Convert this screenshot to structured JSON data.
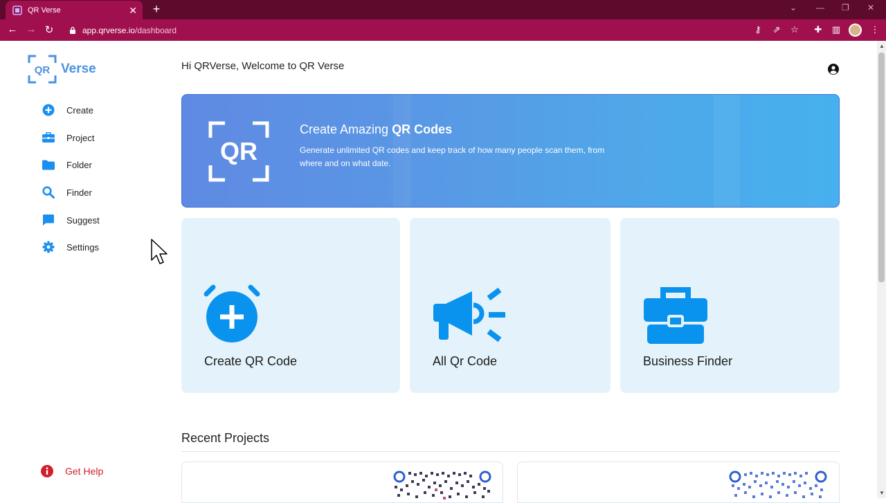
{
  "browser": {
    "tab_title": "QR Verse",
    "url_host": "app.qrverse.io",
    "url_path": "/dashboard"
  },
  "brand": {
    "logo_mark": "QR",
    "logo_word": "Verse",
    "accent": "#4a90e2"
  },
  "sidebar": {
    "items": [
      {
        "label": "Create",
        "icon": "plus-circle-icon"
      },
      {
        "label": "Project",
        "icon": "briefcase-icon"
      },
      {
        "label": "Folder",
        "icon": "folder-icon"
      },
      {
        "label": "Finder",
        "icon": "search-icon"
      },
      {
        "label": "Suggest",
        "icon": "message-icon"
      },
      {
        "label": "Settings",
        "icon": "gear-icon"
      }
    ],
    "help_label": "Get Help"
  },
  "header": {
    "welcome": "Hi QRVerse, Welcome to QR Verse"
  },
  "hero": {
    "title_prefix": "Create Amazing ",
    "title_bold": "QR Codes",
    "description": "Generate unlimited QR codes and keep track of how many people scan them, from where and on what date."
  },
  "cards": [
    {
      "label": "Create QR Code",
      "icon": "alarm-plus-icon"
    },
    {
      "label": "All Qr Code",
      "icon": "megaphone-icon"
    },
    {
      "label": "Business Finder",
      "icon": "toolbox-icon"
    }
  ],
  "recent": {
    "heading": "Recent Projects"
  }
}
